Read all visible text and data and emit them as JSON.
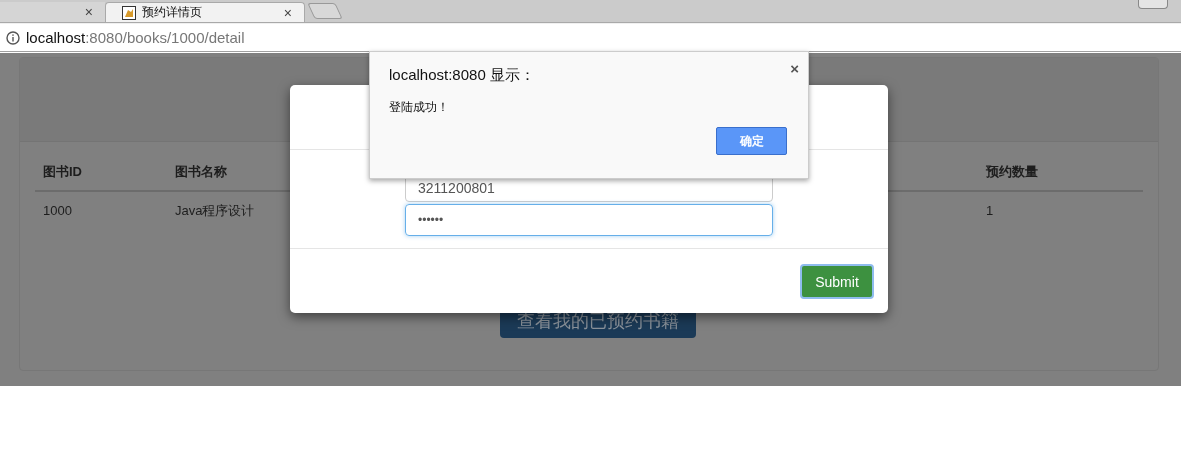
{
  "browser": {
    "tabs": [
      {
        "close": "×",
        "selected": false
      },
      {
        "title": "预约详情页",
        "close": "×",
        "selected": true
      }
    ],
    "address": {
      "host": "localhost",
      "path": ":8080/books/1000/detail"
    }
  },
  "table": {
    "columns": [
      "图书ID",
      "图书名称",
      "预约数量"
    ],
    "rows": [
      [
        "1000",
        "Java程序设计",
        "1"
      ]
    ]
  },
  "page_button": "查看我的已预约书籍",
  "modal": {
    "fields": [
      {
        "kind": "text",
        "value": "3211200801",
        "focused": false
      },
      {
        "kind": "password",
        "value": "••••••",
        "focused": true
      }
    ],
    "submit": "Submit"
  },
  "alert": {
    "title": "localhost:8080 显示：",
    "message": "登陆成功！",
    "close": "×",
    "ok": "确定"
  }
}
